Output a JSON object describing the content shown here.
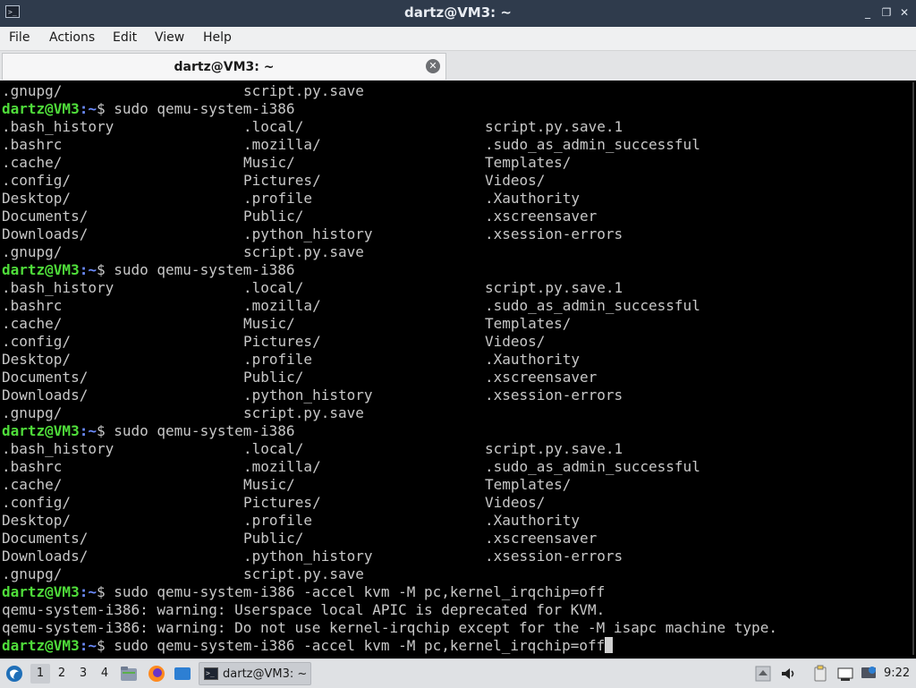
{
  "window": {
    "title": "dartz@VM3: ~",
    "controls": [
      "_",
      "❐",
      "✕"
    ]
  },
  "menu": [
    "File",
    "Actions",
    "Edit",
    "View",
    "Help"
  ],
  "tab": {
    "label": "dartz@VM3: ~"
  },
  "terminal": {
    "lines": [
      {
        "type": "cols",
        "cols": [
          ".gnupg/",
          "script.py.save",
          ""
        ]
      },
      {
        "type": "prompt",
        "user": "dartz@VM3",
        "path": ":~",
        "cmd": "$ sudo qemu-system-i386"
      },
      {
        "type": "cols",
        "cols": [
          ".bash_history",
          ".local/",
          "script.py.save.1"
        ]
      },
      {
        "type": "cols",
        "cols": [
          ".bashrc",
          ".mozilla/",
          ".sudo_as_admin_successful"
        ]
      },
      {
        "type": "cols",
        "cols": [
          ".cache/",
          "Music/",
          "Templates/"
        ]
      },
      {
        "type": "cols",
        "cols": [
          ".config/",
          "Pictures/",
          "Videos/"
        ]
      },
      {
        "type": "cols",
        "cols": [
          "Desktop/",
          ".profile",
          ".Xauthority"
        ]
      },
      {
        "type": "cols",
        "cols": [
          "Documents/",
          "Public/",
          ".xscreensaver"
        ]
      },
      {
        "type": "cols",
        "cols": [
          "Downloads/",
          ".python_history",
          ".xsession-errors"
        ]
      },
      {
        "type": "cols",
        "cols": [
          ".gnupg/",
          "script.py.save",
          ""
        ]
      },
      {
        "type": "prompt",
        "user": "dartz@VM3",
        "path": ":~",
        "cmd": "$ sudo qemu-system-i386"
      },
      {
        "type": "cols",
        "cols": [
          ".bash_history",
          ".local/",
          "script.py.save.1"
        ]
      },
      {
        "type": "cols",
        "cols": [
          ".bashrc",
          ".mozilla/",
          ".sudo_as_admin_successful"
        ]
      },
      {
        "type": "cols",
        "cols": [
          ".cache/",
          "Music/",
          "Templates/"
        ]
      },
      {
        "type": "cols",
        "cols": [
          ".config/",
          "Pictures/",
          "Videos/"
        ]
      },
      {
        "type": "cols",
        "cols": [
          "Desktop/",
          ".profile",
          ".Xauthority"
        ]
      },
      {
        "type": "cols",
        "cols": [
          "Documents/",
          "Public/",
          ".xscreensaver"
        ]
      },
      {
        "type": "cols",
        "cols": [
          "Downloads/",
          ".python_history",
          ".xsession-errors"
        ]
      },
      {
        "type": "cols",
        "cols": [
          ".gnupg/",
          "script.py.save",
          ""
        ]
      },
      {
        "type": "prompt",
        "user": "dartz@VM3",
        "path": ":~",
        "cmd": "$ sudo qemu-system-i386"
      },
      {
        "type": "cols",
        "cols": [
          ".bash_history",
          ".local/",
          "script.py.save.1"
        ]
      },
      {
        "type": "cols",
        "cols": [
          ".bashrc",
          ".mozilla/",
          ".sudo_as_admin_successful"
        ]
      },
      {
        "type": "cols",
        "cols": [
          ".cache/",
          "Music/",
          "Templates/"
        ]
      },
      {
        "type": "cols",
        "cols": [
          ".config/",
          "Pictures/",
          "Videos/"
        ]
      },
      {
        "type": "cols",
        "cols": [
          "Desktop/",
          ".profile",
          ".Xauthority"
        ]
      },
      {
        "type": "cols",
        "cols": [
          "Documents/",
          "Public/",
          ".xscreensaver"
        ]
      },
      {
        "type": "cols",
        "cols": [
          "Downloads/",
          ".python_history",
          ".xsession-errors"
        ]
      },
      {
        "type": "cols",
        "cols": [
          ".gnupg/",
          "script.py.save",
          ""
        ]
      },
      {
        "type": "prompt",
        "user": "dartz@VM3",
        "path": ":~",
        "cmd": "$ sudo qemu-system-i386 -accel kvm -M pc,kernel_irqchip=off"
      },
      {
        "type": "text",
        "text": "qemu-system-i386: warning: Userspace local APIC is deprecated for KVM."
      },
      {
        "type": "text",
        "text": "qemu-system-i386: warning: Do not use kernel-irqchip except for the -M isapc machine type."
      },
      {
        "type": "prompt",
        "user": "dartz@VM3",
        "path": ":~",
        "cmd": "$ sudo qemu-system-i386 -accel kvm -M pc,kernel_irqchip=off",
        "cursor": true
      }
    ]
  },
  "taskbar": {
    "workspaces": [
      "1",
      "2",
      "3",
      "4"
    ],
    "active_workspace": "1",
    "task_label": "dartz@VM3: ~",
    "clock": "9:22",
    "colors": {
      "prompt_user": "#4fdc3a",
      "prompt_path": "#6c8cff",
      "terminal_bg": "#000000",
      "terminal_fg": "#c8c8c8"
    }
  }
}
